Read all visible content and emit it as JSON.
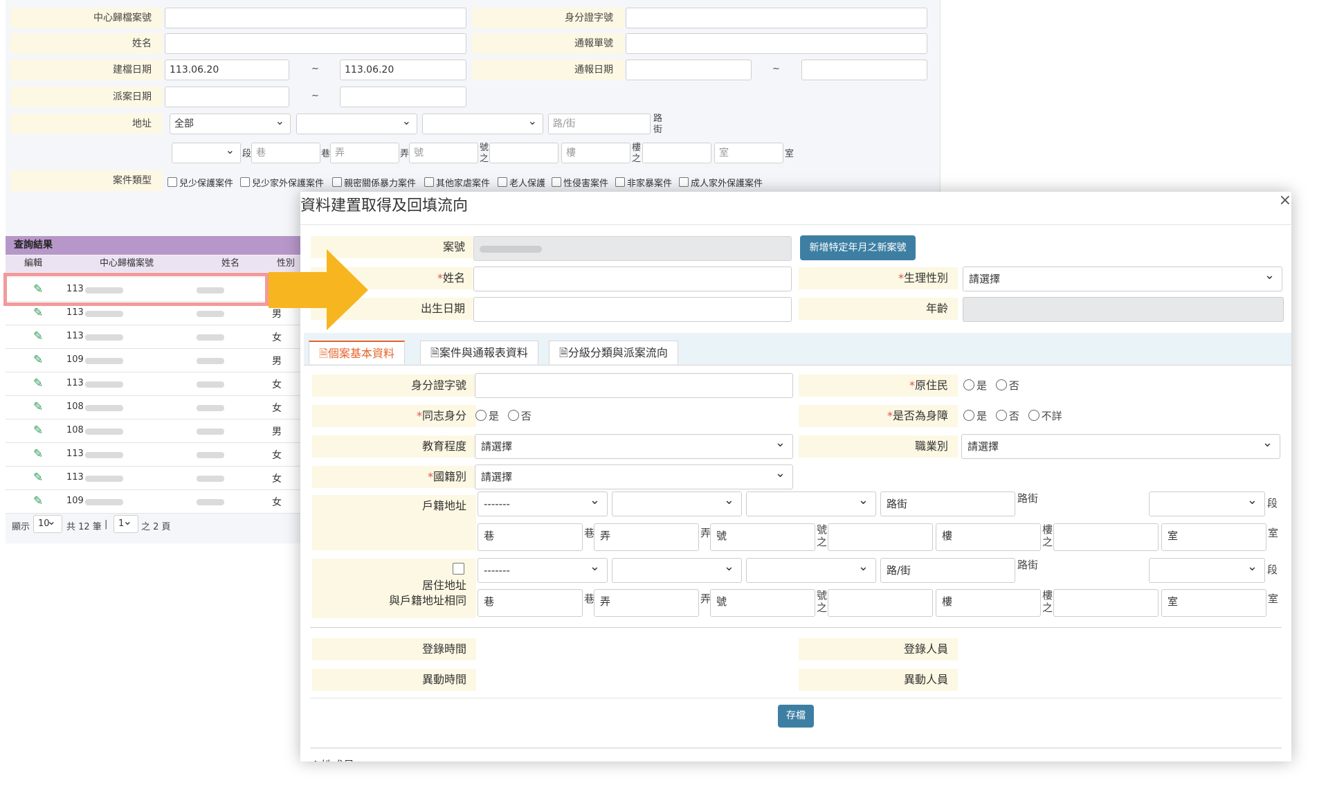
{
  "search": {
    "center_case_no_label": "中心歸檔案號",
    "id_label": "身分證字號",
    "name_label": "姓名",
    "report_no_label": "通報單號",
    "create_date_label": "建檔日期",
    "create_date_from": "113.06.20",
    "create_date_to": "113.06.20",
    "report_date_label": "通報日期",
    "dispatch_date_label": "派案日期",
    "tilde": "~",
    "address_label": "地址",
    "address_county": "全部",
    "road_placeholder": "路/街",
    "road_suffix": "路\n街",
    "section_suffix": "段",
    "lane_placeholder": "巷",
    "lane_suffix": "巷",
    "alley_placeholder": "弄",
    "alley_suffix": "弄",
    "no_placeholder": "號",
    "no_suffix": "號\n之",
    "floor_placeholder": "樓",
    "floor_suffix": "樓\n之",
    "room_placeholder": "室",
    "room_suffix": "室",
    "case_type_label": "案件類型",
    "case_types": [
      "兒少保護案件",
      "兒少家外保護案件",
      "親密關係暴力案件",
      "其他家虐案件",
      "老人保護",
      "性侵害案件",
      "非家暴案件",
      "成人家外保護案件"
    ]
  },
  "results": {
    "title": "查詢結果",
    "headers": [
      "編輯",
      "中心歸檔案號",
      "姓名",
      "性別"
    ],
    "rows": [
      {
        "case_prefix": "113",
        "sex": ""
      },
      {
        "case_prefix": "113",
        "sex": "男"
      },
      {
        "case_prefix": "113",
        "sex": "女"
      },
      {
        "case_prefix": "109",
        "sex": "男"
      },
      {
        "case_prefix": "113",
        "sex": "女"
      },
      {
        "case_prefix": "108",
        "sex": "女"
      },
      {
        "case_prefix": "108",
        "sex": "男"
      },
      {
        "case_prefix": "113",
        "sex": "女"
      },
      {
        "case_prefix": "113",
        "sex": "女"
      },
      {
        "case_prefix": "109",
        "sex": "女"
      }
    ],
    "pager": {
      "show_label": "顯示",
      "page_size": "10",
      "total": "共 12 筆",
      "sep": "|",
      "page": "1",
      "of_pages": "之 2 頁"
    }
  },
  "modal": {
    "title": "資料建置取得及回填流向",
    "close": "×",
    "case_no_label": "案號",
    "new_case_btn": "新增特定年月之新案號",
    "name_label": "姓名",
    "sex_label": "生理性別",
    "select_default": "請選擇",
    "birth_label": "出生日期",
    "age_label": "年齡",
    "tabs": [
      "個案基本資料",
      "案件與通報表資料",
      "分級分類與派案流向"
    ],
    "id_label": "身分證字號",
    "aboriginal_label": "原住民",
    "lgbt_label": "同志身分",
    "disabled_label": "是否為身障",
    "yes": "是",
    "no": "否",
    "unknown": "不詳",
    "edu_label": "教育程度",
    "job_label": "職業別",
    "nationality_label": "國籍別",
    "household_addr_label": "戶籍地址",
    "addr_default": "-------",
    "road_suffix": "路街",
    "residence_label_1": "居住地址",
    "residence_label_2": "與戶籍地址相同",
    "login_time_label": "登錄時間",
    "login_user_label": "登錄人員",
    "change_time_label": "異動時間",
    "change_user_label": "異動人員",
    "save_btn": "存檔",
    "cut_off_text": "Ａ姓成員"
  },
  "colors": {
    "highlight": "#f29a9a",
    "arrow": "#f7b520",
    "button": "#3d7fa3",
    "label_bg": "#fdf8e3",
    "tab_active": "#e4632b",
    "result_header": "#b797c9"
  }
}
